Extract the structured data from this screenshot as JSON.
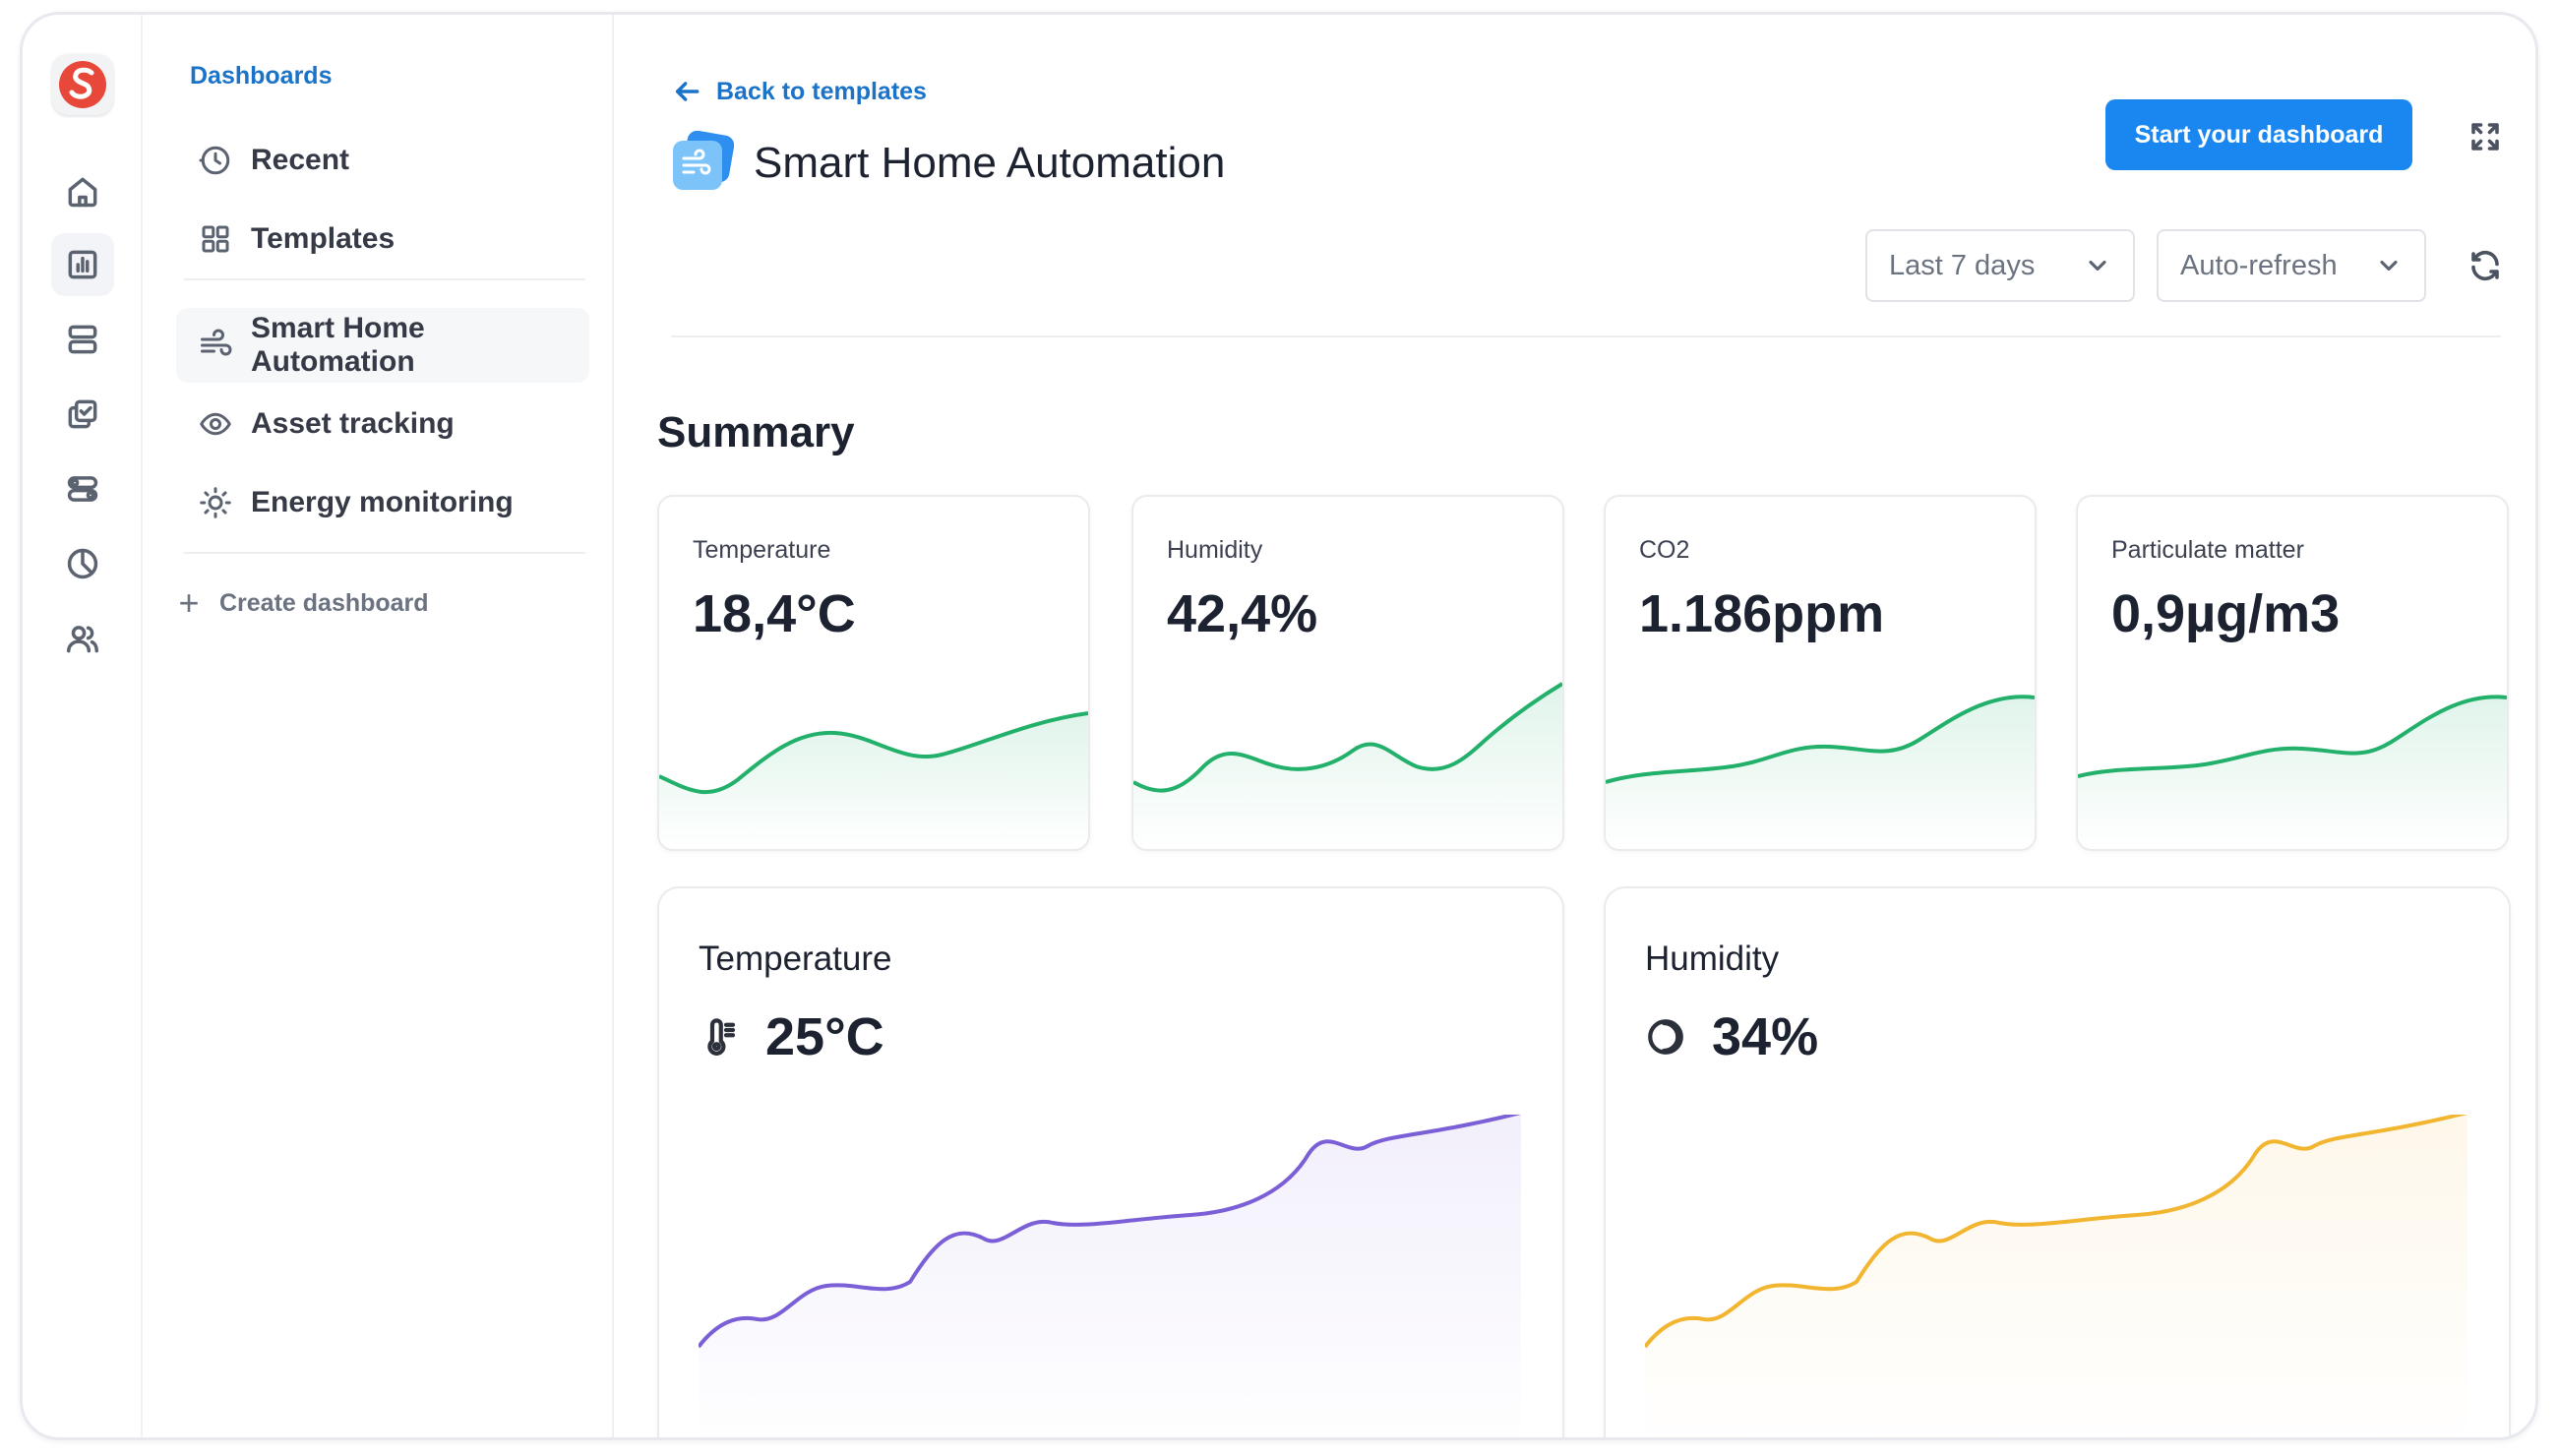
{
  "nav": {
    "heading": "Dashboards",
    "items": [
      {
        "label": "Recent",
        "icon": "clock-icon"
      },
      {
        "label": "Templates",
        "icon": "grid-icon"
      },
      {
        "label": "Smart Home Automation",
        "icon": "wind-icon",
        "active": true
      },
      {
        "label": "Asset tracking",
        "icon": "eye-icon"
      },
      {
        "label": "Energy monitoring",
        "icon": "sun-icon"
      }
    ],
    "create_label": "Create dashboard"
  },
  "rail": {
    "icons": [
      "home-icon",
      "bar-chart-icon",
      "server-icon",
      "copy-check-icon",
      "toggles-icon",
      "pie-chart-icon",
      "users-icon"
    ],
    "active": "bar-chart-icon"
  },
  "header": {
    "back_label": "Back to templates",
    "title": "Smart Home Automation",
    "primary_button": "Start your dashboard",
    "time_range": "Last 7 days",
    "refresh_mode": "Auto-refresh"
  },
  "summary": {
    "title": "Summary",
    "cards": [
      {
        "label": "Temperature",
        "value": "18,4°C"
      },
      {
        "label": "Humidity",
        "value": "42,4%"
      },
      {
        "label": "CO2",
        "value": "1.186ppm"
      },
      {
        "label": "Particulate matter",
        "value": "0,9µg/m3"
      }
    ]
  },
  "panels": [
    {
      "label": "Temperature",
      "value": "25°C",
      "icon": "thermometer-icon",
      "color": "#7b5fd6"
    },
    {
      "label": "Humidity",
      "value": "34%",
      "icon": "half-moon-icon",
      "color": "#f2b530"
    }
  ],
  "colors": {
    "accent": "#1a87f0",
    "link": "#1a73c8",
    "sparkline": "#22b06b"
  }
}
